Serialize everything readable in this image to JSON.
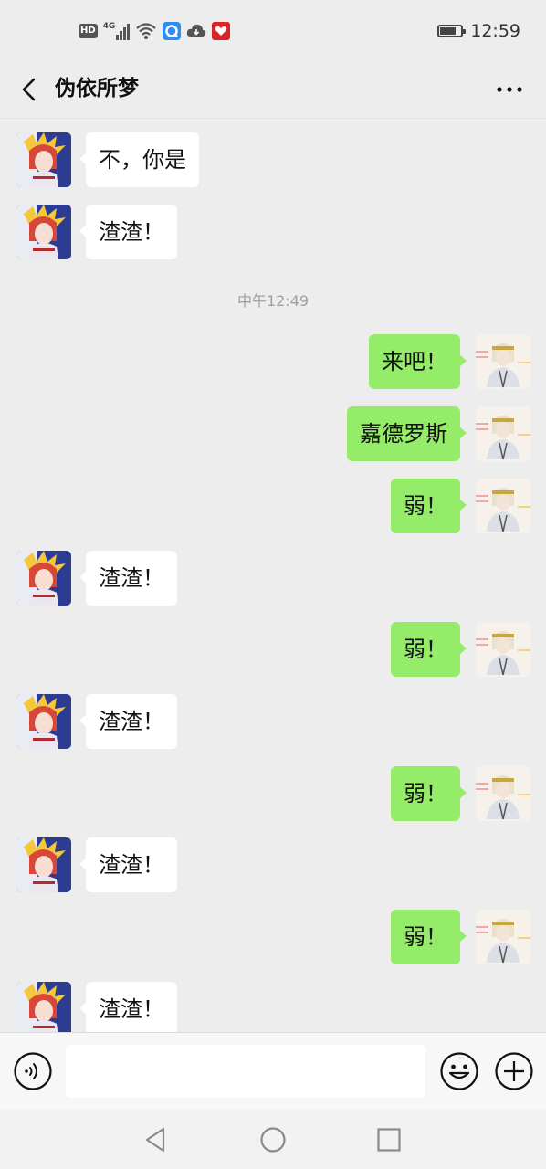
{
  "status_bar": {
    "hd_label": "HD",
    "network_label": "4G",
    "time": "12:59",
    "battery_level": 0.75
  },
  "header": {
    "title": "伪依所梦"
  },
  "messages": [
    {
      "side": "in",
      "text": "不，你是"
    },
    {
      "side": "in",
      "text": "渣渣！"
    },
    {
      "type": "time",
      "text": "中午12:49"
    },
    {
      "side": "out",
      "text": "来吧！"
    },
    {
      "side": "out",
      "text": "嘉德罗斯"
    },
    {
      "side": "out",
      "text": "弱！"
    },
    {
      "side": "in",
      "text": "渣渣！"
    },
    {
      "side": "out",
      "text": "弱！"
    },
    {
      "side": "in",
      "text": "渣渣！"
    },
    {
      "side": "out",
      "text": "弱！"
    },
    {
      "side": "in",
      "text": "渣渣！"
    },
    {
      "side": "out",
      "text": "弱！"
    },
    {
      "side": "in",
      "text": "渣渣！"
    }
  ],
  "input": {
    "value": "",
    "placeholder": ""
  },
  "icons": {
    "back": "chevron-left-icon",
    "more": "more-horizontal-icon",
    "voice": "voice-icon",
    "emoji": "emoji-icon",
    "plus": "plus-circle-icon",
    "nav_back": "triangle-back-icon",
    "nav_home": "circle-home-icon",
    "nav_recent": "square-recent-icon"
  },
  "colors": {
    "background": "#ededed",
    "outgoing_bubble": "#95ec69",
    "incoming_bubble": "#ffffff",
    "timestamp_text": "#a0a0a0"
  }
}
